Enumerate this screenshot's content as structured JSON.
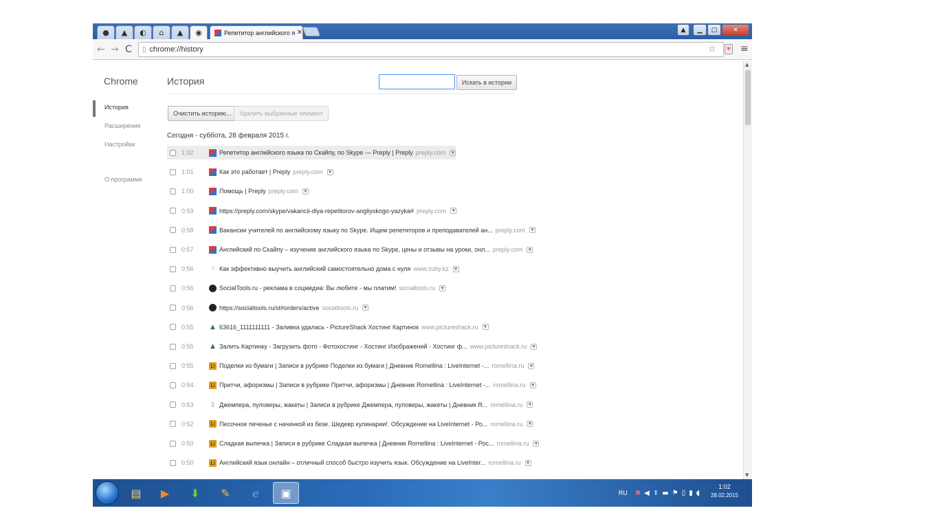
{
  "window": {
    "active_tab_title": "Репетитор английского я",
    "tab_close": "✕"
  },
  "toolbar": {
    "url": "chrome://history"
  },
  "sidebar": {
    "title": "Chrome",
    "items": [
      {
        "label": "История",
        "active": true
      },
      {
        "label": "Расширения",
        "active": false
      },
      {
        "label": "Настройки",
        "active": false
      },
      {
        "label": "О программе",
        "active": false
      }
    ]
  },
  "main": {
    "title": "История",
    "search_button": "Искать в истории",
    "clear_button": "Очистить историю...",
    "remove_button": "Удалить выбранные элемент",
    "day_header": "Сегодня - суббота, 28 февраля 2015 г."
  },
  "history": [
    {
      "time": "1:02",
      "title": "Репетитор английского языка по Скайпу, по Skype — Preply | Preply",
      "domain": "preply.com",
      "icon": "preply-icon"
    },
    {
      "time": "1:01",
      "title": "Как это работает | Preply",
      "domain": "preply.com",
      "icon": "preply-icon"
    },
    {
      "time": "1:00",
      "title": "Помощь | Preply",
      "domain": "preply.com",
      "icon": "preply-icon"
    },
    {
      "time": "0:59",
      "title": "https://preply.com/skype/vakancii-dlya-repetitorov-angliyskogo-yazyka#",
      "domain": "preply.com",
      "icon": "preply-icon"
    },
    {
      "time": "0:58",
      "title": "Вакансии учителей по английскому языку по Skype. Ищем репетиторов и преподавателей ан...",
      "domain": "preply.com",
      "icon": "preply-icon"
    },
    {
      "time": "0:57",
      "title": "Английский по Скайпу – изучение английского языка по Skype, цены и отзывы на уроки, онл...",
      "domain": "preply.com",
      "icon": "preply-icon"
    },
    {
      "time": "0:56",
      "title": "Как эффективно выучить английский самостоятельно дома с нуля",
      "domain": "www.zuby.kz",
      "icon": "zuby-icon"
    },
    {
      "time": "0:56",
      "title": "SocialTools.ru - реклама в соцмедиа: Вы любите - мы платим!",
      "domain": "socialtools.ru",
      "icon": "socialtools-icon"
    },
    {
      "time": "0:56",
      "title": "https://socialtools.ru/st#orders/active",
      "domain": "socialtools.ru",
      "icon": "socialtools-icon"
    },
    {
      "time": "0:55",
      "title": "63616_1111111111 - Заливка удалась - PictureShack Хостинг Картинок",
      "domain": "www.pictureshack.ru",
      "icon": "pictureshack-icon"
    },
    {
      "time": "0:55",
      "title": "Залить Картинку - Загрузить фото - Фотохостинг - Хостинг Изображений - Хостинг ф...",
      "domain": "www.pictureshack.ru",
      "icon": "pictureshack-icon"
    },
    {
      "time": "0:55",
      "title": "Поделки из бумаги | Записи в рубрике Поделки из бумаги | Дневник Romellina : LiveInternet -...",
      "domain": "romellina.ru",
      "icon": "liveinternet-icon"
    },
    {
      "time": "0:54",
      "title": "Притчи, афоризмы | Записи в рубрике Притчи, афоризмы | Дневник Romellina : LiveInternet -...",
      "domain": "romellina.ru",
      "icon": "liveinternet-icon"
    },
    {
      "time": "0:53",
      "title": "Джемпера, пуловеры, жакеты | Записи в рубрике Джемпера, пуловеры, жакеты | Дневник R...",
      "domain": "romellina.ru",
      "icon": "document-icon"
    },
    {
      "time": "0:52",
      "title": "Песочное печенье с начинкой из безе. Шедевр кулинарии!. Обсуждение на LiveInternet - Ро...",
      "domain": "romellina.ru",
      "icon": "liveinternet-icon"
    },
    {
      "time": "0:50",
      "title": "Сладкая выпечка | Записи в рубрике Сладкая выпечка | Дневник Romellina : LiveInternet - Рос...",
      "domain": "romellina.ru",
      "icon": "liveinternet-icon"
    },
    {
      "time": "0:50",
      "title": "Английский язык онлайн – отличный способ быстро изучить язык. Обсуждение на LiveInter...",
      "domain": "romellina.ru",
      "icon": "liveinternet-icon"
    }
  ],
  "taskbar": {
    "language": "RU",
    "time": "1:02",
    "date": "28.02.2015"
  }
}
